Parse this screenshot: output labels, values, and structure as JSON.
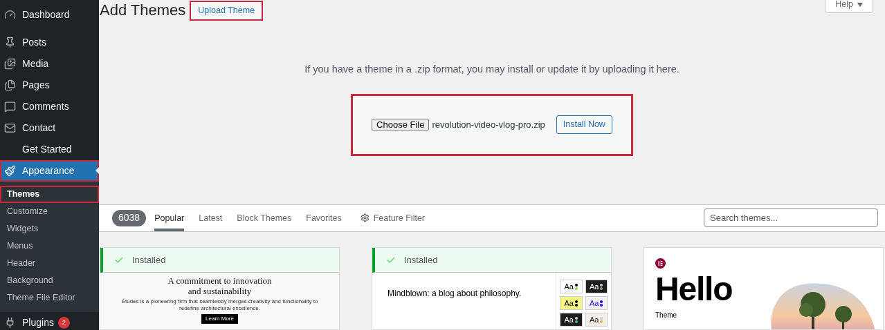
{
  "sidebar": {
    "items": [
      {
        "label": "Dashboard",
        "selected": false
      },
      {
        "label": "Posts",
        "selected": false
      },
      {
        "label": "Media",
        "selected": false
      },
      {
        "label": "Pages",
        "selected": false
      },
      {
        "label": "Comments",
        "selected": false
      },
      {
        "label": "Contact",
        "selected": false
      },
      {
        "label": "Get Started",
        "selected": false
      },
      {
        "label": "Appearance",
        "selected": true,
        "highlighted": true,
        "children": [
          {
            "label": "Themes",
            "selected": true,
            "highlighted": true
          },
          {
            "label": "Customize",
            "selected": false,
            "highlighted": false
          },
          {
            "label": "Widgets",
            "selected": false,
            "highlighted": false
          },
          {
            "label": "Menus",
            "selected": false,
            "highlighted": false
          },
          {
            "label": "Header",
            "selected": false,
            "highlighted": false
          },
          {
            "label": "Background",
            "selected": false,
            "highlighted": false
          },
          {
            "label": "Theme File Editor",
            "selected": false,
            "highlighted": false
          }
        ]
      },
      {
        "label": "Plugins",
        "selected": false,
        "badge": "2"
      }
    ]
  },
  "header": {
    "title": "Add Themes",
    "upload_button": {
      "label": "Upload Theme",
      "highlighted": true
    },
    "help_button": "Help"
  },
  "upload": {
    "instructions": "If you have a theme in a .zip format, you may install or update it by uploading it here.",
    "choose_button": "Choose File",
    "file_name": "revolution-video-vlog-pro.zip",
    "install_button": "Install Now",
    "highlighted": true
  },
  "filter_bar": {
    "count": "6038",
    "tabs": [
      {
        "label": "Popular",
        "selected": true
      },
      {
        "label": "Latest",
        "selected": false
      },
      {
        "label": "Block Themes",
        "selected": false
      },
      {
        "label": "Favorites",
        "selected": false
      }
    ],
    "feature_filter": "Feature Filter",
    "search": {
      "placeholder": "Search themes..."
    }
  },
  "themes": [
    {
      "kind": "studio",
      "installed": true,
      "status": "Installed",
      "heading": "A commitment to innovation and sustainability",
      "body": "Études is a pioneering firm that seamlessly merges creativity and functionality to redefine architectural excellence.",
      "button": "Learn More"
    },
    {
      "kind": "blog",
      "installed": true,
      "status": "Installed",
      "tagline": "Mindblown: a blog about philosophy.",
      "swatches": [
        {
          "label": "Aa",
          "color": "#ffffff",
          "dots": [
            {
              "color": "#000000"
            },
            {
              "color": "#7cdc37"
            }
          ]
        },
        {
          "label": "Aa",
          "color": "#1e1e1e",
          "dots": [
            {
              "color": "#cccccc"
            },
            {
              "color": "#a58d6b"
            }
          ]
        },
        {
          "label": "Aa",
          "color": "#f6f784",
          "dots": [
            {
              "color": "#000000"
            },
            {
              "color": "#000000"
            }
          ]
        },
        {
          "label": "Aa",
          "color": "#f2f2f7",
          "dots": [
            {
              "color": "#1d00ff"
            },
            {
              "color": "#1d00ff"
            }
          ]
        },
        {
          "label": "Aa",
          "color": "#1c1c1c",
          "dots": [
            {
              "color": "#cccccc"
            },
            {
              "color": "#40c080"
            }
          ]
        },
        {
          "label": "Aa",
          "color": "#f3efe9",
          "dots": [
            {
              "color": "#cccccc"
            },
            {
              "color": "#e8a860"
            }
          ]
        }
      ]
    },
    {
      "kind": "hello",
      "installed": false,
      "heading": "Hello",
      "subtitle": "Theme"
    }
  ]
}
